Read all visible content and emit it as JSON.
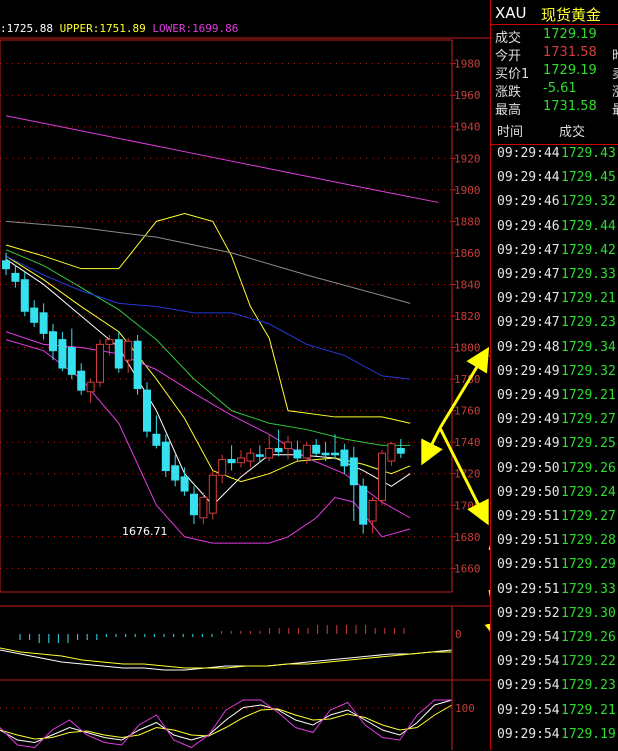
{
  "legend": {
    "mid": ":1725.88",
    "upper": "UPPER:1751.89",
    "lower": "LOWER:1699.86"
  },
  "colors": {
    "up": "#d23c3c",
    "down": "#36e0ee",
    "ma_white": "#ffffff",
    "ma_yellow": "#ffff30",
    "ma_green": "#30c840",
    "ma_blue": "#2438d6",
    "ma_gray": "#8c8c8c",
    "ma_magenta": "#e03ce0",
    "axis": "#c81e1e",
    "arrow": "#ffff00",
    "price_green": "#2fdc2f"
  },
  "annotation": {
    "low_label": "1676.71"
  },
  "chart_data": [
    {
      "type": "line",
      "name": "main-price-chart",
      "ylim": [
        1645,
        1995
      ],
      "yticks": [
        "1980",
        "1960",
        "1940",
        "1920",
        "1900",
        "1880",
        "1860",
        "1840",
        "1820",
        "1800",
        "1780",
        "1760",
        "1740",
        "1720",
        "1700",
        "1680",
        "1660"
      ],
      "candles": [
        [
          1855,
          1860,
          1846,
          1850
        ],
        [
          1847,
          1852,
          1838,
          1842
        ],
        [
          1843,
          1848,
          1820,
          1823
        ],
        [
          1825,
          1830,
          1813,
          1816
        ],
        [
          1822,
          1828,
          1805,
          1809
        ],
        [
          1810,
          1815,
          1792,
          1798
        ],
        [
          1805,
          1810,
          1785,
          1787
        ],
        [
          1800,
          1812,
          1780,
          1783
        ],
        [
          1785,
          1790,
          1770,
          1773
        ],
        [
          1772,
          1780,
          1765,
          1778
        ],
        [
          1778,
          1805,
          1775,
          1802
        ],
        [
          1802,
          1808,
          1795,
          1805
        ],
        [
          1805,
          1810,
          1784,
          1787
        ],
        [
          1792,
          1806,
          1784,
          1804
        ],
        [
          1804,
          1808,
          1770,
          1774
        ],
        [
          1773,
          1778,
          1743,
          1747
        ],
        [
          1745,
          1757,
          1736,
          1738
        ],
        [
          1740,
          1745,
          1718,
          1722
        ],
        [
          1725,
          1732,
          1712,
          1716
        ],
        [
          1718,
          1724,
          1706,
          1709
        ],
        [
          1707,
          1712,
          1688,
          1694
        ],
        [
          1692,
          1708,
          1688,
          1705
        ],
        [
          1695,
          1722,
          1691,
          1719
        ],
        [
          1719,
          1732,
          1714,
          1729
        ],
        [
          1729,
          1738,
          1722,
          1727
        ],
        [
          1727,
          1735,
          1724,
          1730
        ],
        [
          1728,
          1736,
          1724,
          1733
        ],
        [
          1732,
          1738,
          1727,
          1731
        ],
        [
          1730,
          1745,
          1728,
          1736
        ],
        [
          1736,
          1748,
          1731,
          1734
        ],
        [
          1736,
          1744,
          1729,
          1740
        ],
        [
          1735,
          1741,
          1728,
          1730
        ],
        [
          1730,
          1740,
          1726,
          1738
        ],
        [
          1738,
          1742,
          1731,
          1733
        ],
        [
          1733,
          1740,
          1728,
          1732
        ],
        [
          1733,
          1745,
          1729,
          1732
        ],
        [
          1735,
          1739,
          1720,
          1725
        ],
        [
          1730,
          1737,
          1690,
          1713
        ],
        [
          1712,
          1717,
          1682,
          1688
        ],
        [
          1690,
          1705,
          1682,
          1703
        ],
        [
          1703,
          1735,
          1700,
          1733
        ],
        [
          1728,
          1740,
          1725,
          1739
        ],
        [
          1736,
          1742,
          1730,
          1733
        ]
      ],
      "series": [
        {
          "name": "UPPER",
          "color": "#ffff30",
          "x": [
            0,
            4,
            8,
            12,
            16,
            19,
            22,
            24,
            26,
            28,
            30,
            35,
            40,
            43
          ],
          "y": [
            1865,
            1858,
            1850,
            1850,
            1880,
            1885,
            1880,
            1858,
            1826,
            1806,
            1760,
            1756,
            1756,
            1752
          ]
        },
        {
          "name": "LOWER",
          "color": "#e03ce0",
          "x": [
            0,
            4,
            8,
            12,
            16,
            19,
            22,
            24,
            26,
            28,
            30,
            33,
            35,
            37,
            40,
            43
          ],
          "y": [
            1805,
            1798,
            1780,
            1752,
            1700,
            1680,
            1676,
            1676,
            1676,
            1676,
            1680,
            1692,
            1705,
            1702,
            1680,
            1685
          ]
        },
        {
          "name": "ma-white",
          "color": "#ffffff",
          "x": [
            0,
            4,
            8,
            12,
            16,
            19,
            22,
            25,
            28,
            31,
            35,
            38,
            41,
            43
          ],
          "y": [
            1856,
            1840,
            1820,
            1800,
            1760,
            1720,
            1700,
            1718,
            1732,
            1732,
            1730,
            1722,
            1712,
            1720
          ]
        },
        {
          "name": "ma-yellow",
          "color": "#ffff30",
          "x": [
            0,
            4,
            8,
            12,
            16,
            19,
            22,
            25,
            28,
            31,
            35,
            38,
            41,
            43
          ],
          "y": [
            1858,
            1843,
            1826,
            1810,
            1780,
            1755,
            1722,
            1715,
            1720,
            1728,
            1730,
            1726,
            1720,
            1725
          ]
        },
        {
          "name": "ma-green",
          "color": "#30c840",
          "x": [
            0,
            4,
            8,
            12,
            16,
            20,
            24,
            28,
            32,
            36,
            40,
            43
          ],
          "y": [
            1862,
            1852,
            1838,
            1824,
            1805,
            1780,
            1760,
            1752,
            1748,
            1742,
            1738,
            1738
          ]
        },
        {
          "name": "ma-magenta-short",
          "color": "#e03ce0",
          "x": [
            0,
            4,
            8,
            12,
            16,
            20,
            24,
            28,
            32,
            36,
            40,
            43
          ],
          "y": [
            1810,
            1802,
            1800,
            1796,
            1786,
            1771,
            1757,
            1745,
            1730,
            1720,
            1702,
            1692
          ]
        },
        {
          "name": "ma-blue",
          "color": "#2438d6",
          "x": [
            0,
            4,
            8,
            12,
            16,
            20,
            24,
            28,
            32,
            36,
            40,
            43
          ],
          "y": [
            1858,
            1846,
            1836,
            1828,
            1826,
            1822,
            1822,
            1815,
            1802,
            1795,
            1782,
            1780
          ]
        },
        {
          "name": "ma-gray",
          "color": "#8c8c8c",
          "x": [
            0,
            8,
            16,
            24,
            32,
            40,
            43
          ],
          "y": [
            1880,
            1876,
            1870,
            1860,
            1846,
            1833,
            1828
          ]
        },
        {
          "name": "ma-magenta-long",
          "color": "#e03ce0",
          "x": [
            0,
            10,
            20,
            30,
            40,
            46
          ],
          "y": [
            1947,
            1935,
            1923,
            1911,
            1899,
            1892
          ]
        }
      ]
    },
    {
      "type": "bar",
      "name": "macd-panel",
      "ylabel_tick": "0",
      "histogram": [
        -2,
        -2,
        -3,
        -3,
        -3,
        -3,
        -2,
        -2,
        -2,
        -1,
        -1,
        -1,
        -1,
        -1,
        -1,
        -1,
        -1,
        -1,
        -1,
        -1,
        -1,
        1,
        1,
        1,
        1,
        1,
        2,
        2,
        2,
        2,
        2,
        3,
        3,
        3,
        3,
        3,
        3,
        2,
        2,
        2,
        2
      ],
      "series": [
        {
          "name": "dif",
          "color": "#ffffff",
          "y": [
            -1,
            -3,
            -5,
            -7,
            -8,
            -9,
            -10,
            -10,
            -11,
            -11,
            -10,
            -9,
            -9,
            -9,
            -8,
            -7,
            -6,
            -5,
            -4,
            -3,
            -3,
            -2,
            -1
          ]
        },
        {
          "name": "dea",
          "color": "#ffff30",
          "y": [
            0,
            -2,
            -3,
            -4,
            -6,
            -7,
            -8,
            -8,
            -9,
            -10,
            -10,
            -10,
            -9,
            -9,
            -8,
            -8,
            -7,
            -6,
            -5,
            -4,
            -3,
            -2,
            -2
          ]
        }
      ]
    },
    {
      "type": "line",
      "name": "kdj-panel",
      "ylabel_tick": "100",
      "series": [
        {
          "name": "k",
          "color": "#ffffff",
          "y": [
            40,
            20,
            15,
            30,
            45,
            35,
            25,
            20,
            40,
            55,
            30,
            20,
            30,
            60,
            85,
            90,
            80,
            60,
            50,
            70,
            80,
            60,
            40,
            30,
            55,
            90,
            100
          ]
        },
        {
          "name": "d",
          "color": "#ffff30",
          "y": [
            40,
            30,
            22,
            25,
            35,
            38,
            30,
            25,
            30,
            45,
            40,
            30,
            28,
            45,
            65,
            80,
            82,
            70,
            60,
            62,
            72,
            65,
            50,
            40,
            45,
            70,
            90
          ]
        },
        {
          "name": "j",
          "color": "#e03ce0",
          "y": [
            45,
            10,
            5,
            40,
            60,
            30,
            15,
            10,
            50,
            70,
            20,
            5,
            30,
            80,
            100,
            100,
            75,
            45,
            35,
            80,
            95,
            50,
            25,
            20,
            70,
            100,
            100
          ]
        }
      ]
    }
  ],
  "quote": {
    "symbol": "XAU",
    "name": "现货黄金",
    "rows": [
      {
        "k": "成交",
        "v": "1729.19",
        "color": "#2fdc2f",
        "x": ""
      },
      {
        "k": "今开",
        "v": "1731.58",
        "color": "#d23c3c",
        "x": "昨"
      },
      {
        "k": "买价1",
        "v": "1729.19",
        "color": "#2fdc2f",
        "x": "卖"
      },
      {
        "k": "涨跌",
        "v": "-5.61",
        "color": "#2fdc2f",
        "x": "涨"
      },
      {
        "k": "最高",
        "v": "1731.58",
        "color": "#2fdc2f",
        "x": "最"
      }
    ],
    "trade_headers": [
      "时间",
      "成交"
    ]
  },
  "trades": [
    {
      "t": "09:29:44",
      "p": "1729.43"
    },
    {
      "t": "09:29:44",
      "p": "1729.45"
    },
    {
      "t": "09:29:46",
      "p": "1729.32"
    },
    {
      "t": "09:29:46",
      "p": "1729.44"
    },
    {
      "t": "09:29:47",
      "p": "1729.42"
    },
    {
      "t": "09:29:47",
      "p": "1729.33"
    },
    {
      "t": "09:29:47",
      "p": "1729.21"
    },
    {
      "t": "09:29:47",
      "p": "1729.23"
    },
    {
      "t": "09:29:48",
      "p": "1729.34"
    },
    {
      "t": "09:29:49",
      "p": "1729.32"
    },
    {
      "t": "09:29:49",
      "p": "1729.21"
    },
    {
      "t": "09:29:49",
      "p": "1729.27"
    },
    {
      "t": "09:29:49",
      "p": "1729.25"
    },
    {
      "t": "09:29:50",
      "p": "1729.26"
    },
    {
      "t": "09:29:50",
      "p": "1729.24"
    },
    {
      "t": "09:29:51",
      "p": "1729.27"
    },
    {
      "t": "09:29:51",
      "p": "1729.28"
    },
    {
      "t": "09:29:51",
      "p": "1729.29"
    },
    {
      "t": "09:29:51",
      "p": "1729.33"
    },
    {
      "t": "09:29:52",
      "p": "1729.30"
    },
    {
      "t": "09:29:54",
      "p": "1729.26"
    },
    {
      "t": "09:29:54",
      "p": "1729.22"
    },
    {
      "t": "09:29:54",
      "p": "1729.23"
    },
    {
      "t": "09:29:54",
      "p": "1729.21"
    },
    {
      "t": "09:29:54",
      "p": "1729.19"
    }
  ]
}
